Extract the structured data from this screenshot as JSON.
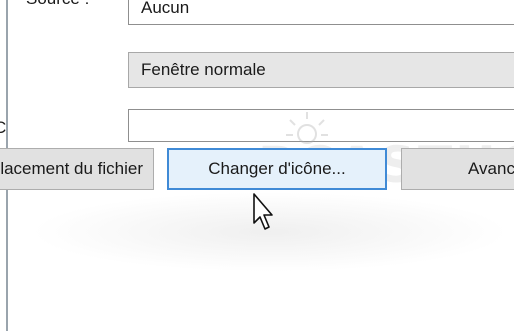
{
  "form": {
    "top_label": "Source :",
    "top_value": "Aucun",
    "run_value": "Fenêtre normale",
    "comment_label": "C",
    "comment_value": ""
  },
  "buttons": {
    "open_location": "Emplacement du fichier",
    "change_icon": "Changer d'icône...",
    "advanced": "Avancé..."
  },
  "watermark": {
    "text": "PCASTUCES"
  },
  "colors": {
    "primary_border": "#3f8ad6",
    "primary_bg": "#e5f1fb",
    "button_bg": "#e1e1e1"
  }
}
